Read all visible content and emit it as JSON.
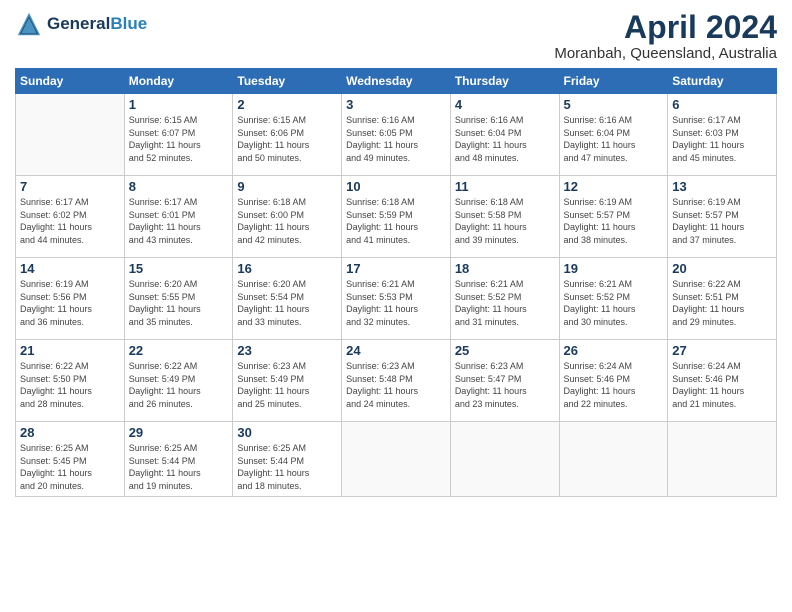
{
  "header": {
    "logo_line1": "General",
    "logo_line2": "Blue",
    "month": "April 2024",
    "location": "Moranbah, Queensland, Australia"
  },
  "weekdays": [
    "Sunday",
    "Monday",
    "Tuesday",
    "Wednesday",
    "Thursday",
    "Friday",
    "Saturday"
  ],
  "weeks": [
    [
      {
        "day": "",
        "info": ""
      },
      {
        "day": "1",
        "info": "Sunrise: 6:15 AM\nSunset: 6:07 PM\nDaylight: 11 hours\nand 52 minutes."
      },
      {
        "day": "2",
        "info": "Sunrise: 6:15 AM\nSunset: 6:06 PM\nDaylight: 11 hours\nand 50 minutes."
      },
      {
        "day": "3",
        "info": "Sunrise: 6:16 AM\nSunset: 6:05 PM\nDaylight: 11 hours\nand 49 minutes."
      },
      {
        "day": "4",
        "info": "Sunrise: 6:16 AM\nSunset: 6:04 PM\nDaylight: 11 hours\nand 48 minutes."
      },
      {
        "day": "5",
        "info": "Sunrise: 6:16 AM\nSunset: 6:04 PM\nDaylight: 11 hours\nand 47 minutes."
      },
      {
        "day": "6",
        "info": "Sunrise: 6:17 AM\nSunset: 6:03 PM\nDaylight: 11 hours\nand 45 minutes."
      }
    ],
    [
      {
        "day": "7",
        "info": "Sunrise: 6:17 AM\nSunset: 6:02 PM\nDaylight: 11 hours\nand 44 minutes."
      },
      {
        "day": "8",
        "info": "Sunrise: 6:17 AM\nSunset: 6:01 PM\nDaylight: 11 hours\nand 43 minutes."
      },
      {
        "day": "9",
        "info": "Sunrise: 6:18 AM\nSunset: 6:00 PM\nDaylight: 11 hours\nand 42 minutes."
      },
      {
        "day": "10",
        "info": "Sunrise: 6:18 AM\nSunset: 5:59 PM\nDaylight: 11 hours\nand 41 minutes."
      },
      {
        "day": "11",
        "info": "Sunrise: 6:18 AM\nSunset: 5:58 PM\nDaylight: 11 hours\nand 39 minutes."
      },
      {
        "day": "12",
        "info": "Sunrise: 6:19 AM\nSunset: 5:57 PM\nDaylight: 11 hours\nand 38 minutes."
      },
      {
        "day": "13",
        "info": "Sunrise: 6:19 AM\nSunset: 5:57 PM\nDaylight: 11 hours\nand 37 minutes."
      }
    ],
    [
      {
        "day": "14",
        "info": "Sunrise: 6:19 AM\nSunset: 5:56 PM\nDaylight: 11 hours\nand 36 minutes."
      },
      {
        "day": "15",
        "info": "Sunrise: 6:20 AM\nSunset: 5:55 PM\nDaylight: 11 hours\nand 35 minutes."
      },
      {
        "day": "16",
        "info": "Sunrise: 6:20 AM\nSunset: 5:54 PM\nDaylight: 11 hours\nand 33 minutes."
      },
      {
        "day": "17",
        "info": "Sunrise: 6:21 AM\nSunset: 5:53 PM\nDaylight: 11 hours\nand 32 minutes."
      },
      {
        "day": "18",
        "info": "Sunrise: 6:21 AM\nSunset: 5:52 PM\nDaylight: 11 hours\nand 31 minutes."
      },
      {
        "day": "19",
        "info": "Sunrise: 6:21 AM\nSunset: 5:52 PM\nDaylight: 11 hours\nand 30 minutes."
      },
      {
        "day": "20",
        "info": "Sunrise: 6:22 AM\nSunset: 5:51 PM\nDaylight: 11 hours\nand 29 minutes."
      }
    ],
    [
      {
        "day": "21",
        "info": "Sunrise: 6:22 AM\nSunset: 5:50 PM\nDaylight: 11 hours\nand 28 minutes."
      },
      {
        "day": "22",
        "info": "Sunrise: 6:22 AM\nSunset: 5:49 PM\nDaylight: 11 hours\nand 26 minutes."
      },
      {
        "day": "23",
        "info": "Sunrise: 6:23 AM\nSunset: 5:49 PM\nDaylight: 11 hours\nand 25 minutes."
      },
      {
        "day": "24",
        "info": "Sunrise: 6:23 AM\nSunset: 5:48 PM\nDaylight: 11 hours\nand 24 minutes."
      },
      {
        "day": "25",
        "info": "Sunrise: 6:23 AM\nSunset: 5:47 PM\nDaylight: 11 hours\nand 23 minutes."
      },
      {
        "day": "26",
        "info": "Sunrise: 6:24 AM\nSunset: 5:46 PM\nDaylight: 11 hours\nand 22 minutes."
      },
      {
        "day": "27",
        "info": "Sunrise: 6:24 AM\nSunset: 5:46 PM\nDaylight: 11 hours\nand 21 minutes."
      }
    ],
    [
      {
        "day": "28",
        "info": "Sunrise: 6:25 AM\nSunset: 5:45 PM\nDaylight: 11 hours\nand 20 minutes."
      },
      {
        "day": "29",
        "info": "Sunrise: 6:25 AM\nSunset: 5:44 PM\nDaylight: 11 hours\nand 19 minutes."
      },
      {
        "day": "30",
        "info": "Sunrise: 6:25 AM\nSunset: 5:44 PM\nDaylight: 11 hours\nand 18 minutes."
      },
      {
        "day": "",
        "info": ""
      },
      {
        "day": "",
        "info": ""
      },
      {
        "day": "",
        "info": ""
      },
      {
        "day": "",
        "info": ""
      }
    ]
  ]
}
